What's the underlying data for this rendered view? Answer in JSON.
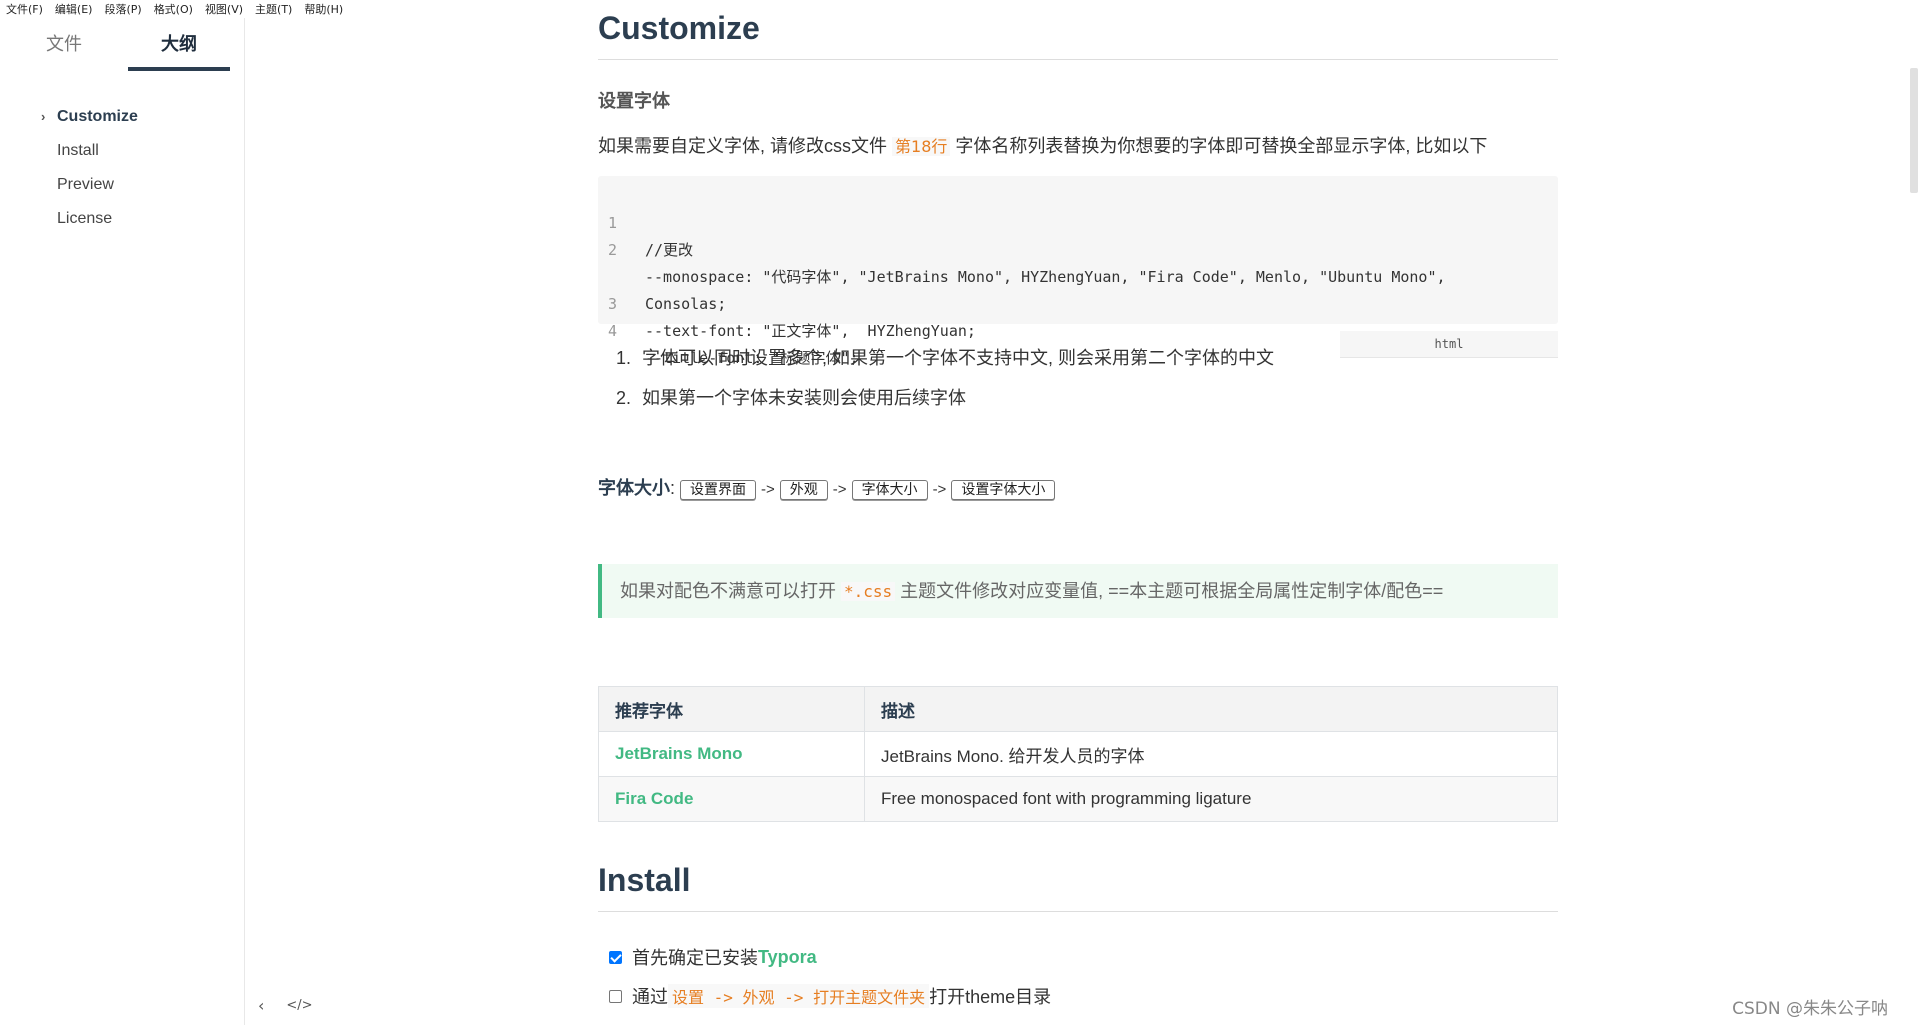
{
  "menu": [
    "文件(F)",
    "编辑(E)",
    "段落(P)",
    "格式(O)",
    "视图(V)",
    "主题(T)",
    "帮助(H)"
  ],
  "sidebar": {
    "tabs": {
      "files": "文件",
      "outline": "大纲"
    },
    "outline": [
      {
        "label": "Customize",
        "active": true
      },
      {
        "label": "Install",
        "active": false
      },
      {
        "label": "Preview",
        "active": false
      },
      {
        "label": "License",
        "active": false
      }
    ],
    "footer_icons": [
      "chevron-left-icon",
      "source-code-icon"
    ]
  },
  "doc": {
    "h1_customize": "Customize",
    "h3_font": "设置字体",
    "para_before": "如果需要自定义字体, 请修改css文件 ",
    "para_highlight": "第18行",
    "para_after": " 字体名称列表替换为你想要的字体即可替换全部显示字体, 比如以下",
    "code": {
      "lines": [
        {
          "n": "1",
          "text": "//更改"
        },
        {
          "n": "2",
          "text": "--monospace: \"代码字体\", \"JetBrains Mono\", HYZhengYuan, \"Fira Code\", Menlo, \"Ubuntu Mono\","
        },
        {
          "n": "",
          "text": "Consolas;"
        },
        {
          "n": "3",
          "text": "--text-font: \"正文字体\",  HYZhengYuan;"
        },
        {
          "n": "4",
          "text": "--title-font: \"标题字体\";"
        }
      ],
      "language": "html"
    },
    "ordered_list": [
      {
        "n": "1.",
        "text": "字体可以同时设置多个, 如果第一个字体不支持中文, 则会采用第二个字体的中文"
      },
      {
        "n": "2.",
        "text": "如果第一个字体未安装则会使用后续字体"
      }
    ],
    "fontsize": {
      "label": "字体大小",
      "colon": ":",
      "keys": [
        "设置界面",
        "外观",
        "字体大小",
        "设置字体大小"
      ],
      "arrow": "->"
    },
    "tip": {
      "before": "如果对配色不满意可以打开 ",
      "code": "*.css",
      "after": " 主题文件修改对应变量值, ==本主题可根据全局属性定制字体/配色=="
    },
    "table": {
      "headers": [
        "推荐字体",
        "描述"
      ],
      "rows": [
        {
          "name": "JetBrains Mono",
          "desc": "JetBrains Mono. 给开发人员的字体"
        },
        {
          "name": "Fira Code",
          "desc": "Free monospaced font with programming ligature"
        }
      ]
    },
    "h1_install": "Install",
    "tasks": [
      {
        "checked": true,
        "before": "首先确定已安装 ",
        "highlight": "Typora",
        "after": ""
      },
      {
        "checked": false,
        "before": "通过 ",
        "highlight": "设置 -> 外观 -> 打开主题文件夹",
        "after": " 打开theme目录"
      }
    ]
  },
  "watermark": "CSDN @朱朱公子呐"
}
